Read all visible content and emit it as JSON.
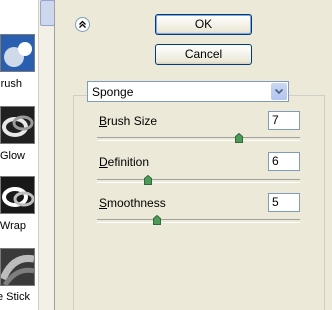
{
  "gallery": {
    "items": [
      {
        "label": "Brush"
      },
      {
        "label": "Glow"
      },
      {
        "label": "c Wrap"
      },
      {
        "label": "ge Stick"
      }
    ]
  },
  "buttons": {
    "ok": "OK",
    "cancel": "Cancel"
  },
  "filter": {
    "selected": "Sponge"
  },
  "params": [
    {
      "label_mnemonic": "B",
      "label_rest": "rush Size",
      "value": "7"
    },
    {
      "label_mnemonic": "D",
      "label_rest": "efinition",
      "value": "6"
    },
    {
      "label_mnemonic": "S",
      "label_rest": "moothness",
      "value": "5"
    }
  ],
  "colors": {
    "dialog_bg": "#ece9d8",
    "slider_thumb": "#4d9a59",
    "accent_border": "#7f9db9"
  }
}
